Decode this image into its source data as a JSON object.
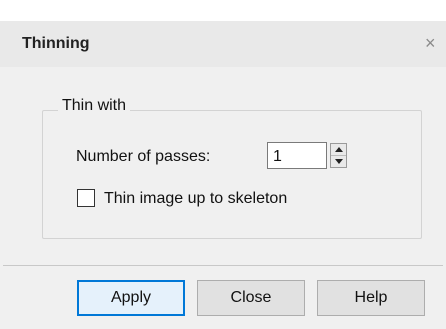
{
  "dialog": {
    "title": "Thinning",
    "close_glyph": "×"
  },
  "group": {
    "legend": "Thin with",
    "passes_label": "Number of passes:",
    "passes_value": "1",
    "skeleton_label": "Thin image up to skeleton",
    "skeleton_checked": false
  },
  "buttons": {
    "apply": "Apply",
    "close": "Close",
    "help": "Help"
  },
  "colors": {
    "default_button_border": "#0078d7",
    "dialog_background": "#f0f0f0"
  }
}
